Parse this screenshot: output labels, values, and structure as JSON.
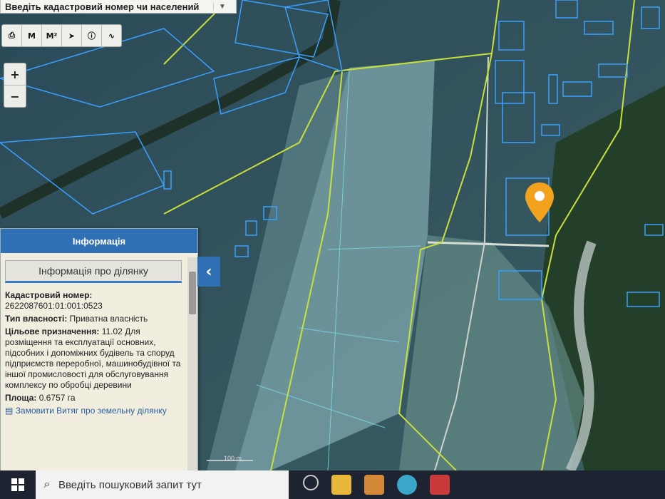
{
  "search": {
    "placeholder": "Введіть кадастровий номер чи населений"
  },
  "toolbar": {
    "print_label": "⎙",
    "measure_line_label": "M",
    "measure_area_label": "M²",
    "pointer_label": "➤",
    "info_label": "ⓘ",
    "route_label": "∿"
  },
  "zoom": {
    "in_label": "+",
    "out_label": "−"
  },
  "map": {
    "scale_label": "100 m"
  },
  "panel": {
    "title": "Інформація",
    "button_label": "Інформація про ділянку",
    "cadastral_label": "Кадастровий номер:",
    "cadastral_value": "2622087601:01:001:0523",
    "ownership_label": "Тип власності:",
    "ownership_value": "Приватна власність",
    "purpose_label": "Цільове призначення:",
    "purpose_value": "11.02 Для розміщення та експлуатації основних, підсобних і допоміжних будівель та споруд підприємств переробної, машинобудівної та іншої промисловості для обслуговування комплексу по обробці деревини",
    "area_label": "Площа:",
    "area_value": "0.6757 га",
    "order_link": "Замовити Витяг про земельну ділянку",
    "collapse_label": "‹"
  },
  "taskbar": {
    "search_placeholder": "Введіть пошуковий запит тут"
  },
  "colors": {
    "panel_header": "#2f6fb4",
    "parcel_outline": "#3aa0ff",
    "boundary": "#c8e03a",
    "marker": "#f2a21c"
  }
}
